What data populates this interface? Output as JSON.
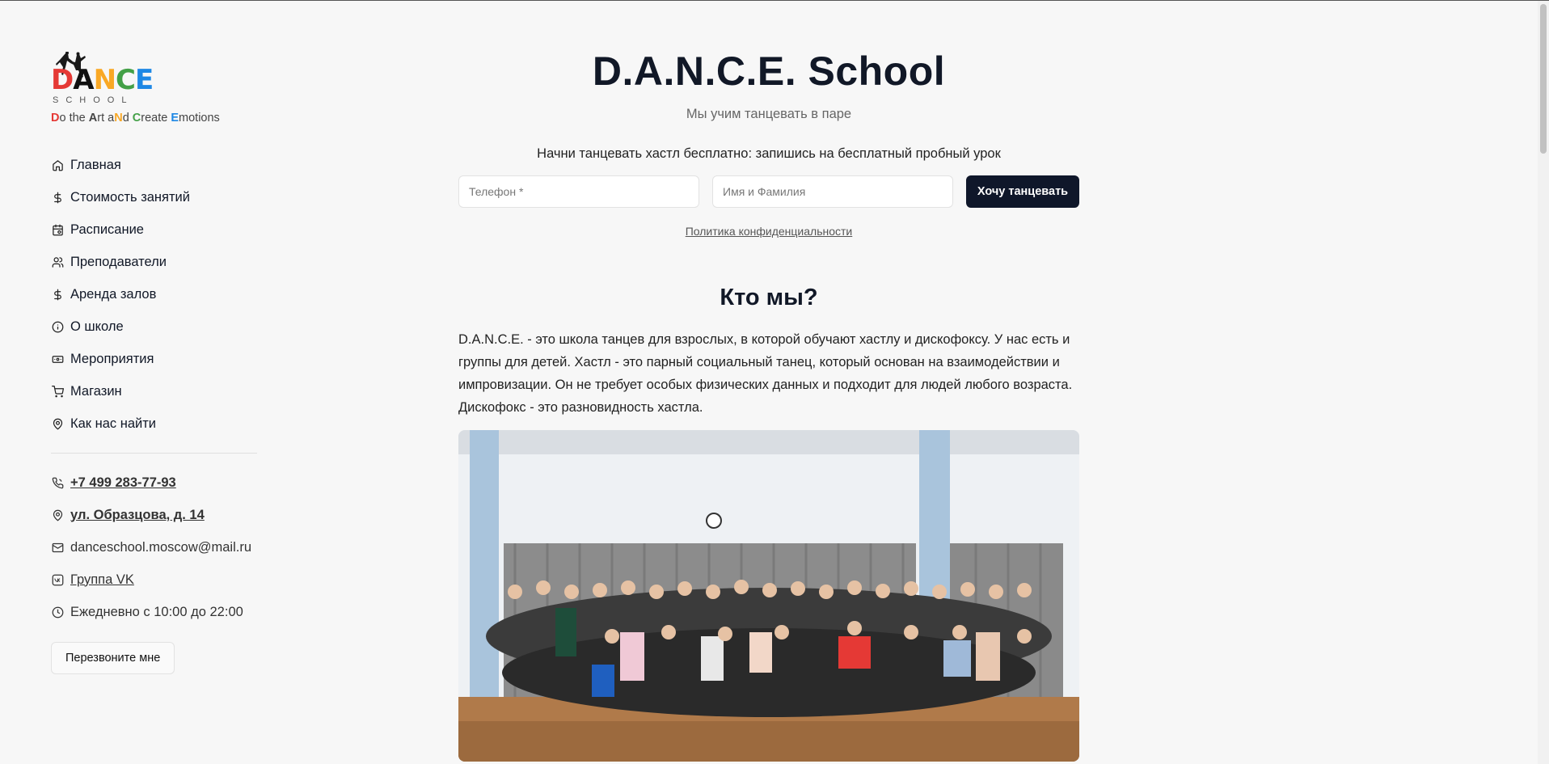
{
  "brand": {
    "logo_letters": [
      "D",
      "A",
      "N",
      "C",
      "E"
    ],
    "logo_colors": [
      "#e53935",
      "#111111",
      "#f9a825",
      "#43a047",
      "#1e88e5"
    ],
    "logo_subword": "SCHOOL",
    "tagline_parts": [
      {
        "t": "D",
        "b": true,
        "c": "#e53935"
      },
      {
        "t": "o the ",
        "b": false,
        "c": "#444444"
      },
      {
        "t": "A",
        "b": true,
        "c": "#444444"
      },
      {
        "t": "rt a",
        "b": false,
        "c": "#444444"
      },
      {
        "t": "N",
        "b": true,
        "c": "#f9a825"
      },
      {
        "t": "d ",
        "b": false,
        "c": "#444444"
      },
      {
        "t": "C",
        "b": true,
        "c": "#43a047"
      },
      {
        "t": "reate ",
        "b": false,
        "c": "#444444"
      },
      {
        "t": "E",
        "b": true,
        "c": "#1e88e5"
      },
      {
        "t": "motions",
        "b": false,
        "c": "#444444"
      }
    ]
  },
  "sidebar": {
    "nav": [
      {
        "label": "Главная",
        "icon": "home-icon"
      },
      {
        "label": "Стоимость занятий",
        "icon": "dollar-icon"
      },
      {
        "label": "Расписание",
        "icon": "calendar-icon"
      },
      {
        "label": "Преподаватели",
        "icon": "users-icon"
      },
      {
        "label": "Аренда залов",
        "icon": "dollar-icon"
      },
      {
        "label": "О школе",
        "icon": "info-icon"
      },
      {
        "label": "Мероприятия",
        "icon": "ticket-icon"
      },
      {
        "label": "Магазин",
        "icon": "cart-icon"
      },
      {
        "label": "Как нас найти",
        "icon": "map-pin-icon"
      }
    ],
    "contacts": {
      "phone": "+7 499 283-77-93",
      "address": "ул. Образцова, д. 14",
      "email": "danceschool.moscow@mail.ru",
      "vk": "Группа VK",
      "hours": "Ежедневно с 10:00 до 22:00"
    },
    "callback_label": "Перезвоните мне"
  },
  "main": {
    "title": "D.A.N.C.E. School",
    "subtitle": "Мы учим танцевать в паре",
    "cta_text": "Начни танцевать хастл бесплатно: запишись на бесплатный пробный урок",
    "phone_placeholder": "Телефон *",
    "name_placeholder": "Имя и Фамилия",
    "submit_label": "Хочу танцевать",
    "privacy_label": "Политика конфиденциальности",
    "section_title": "Кто мы?",
    "about_text": "D.A.N.C.E. - это школа танцев для взрослых, в которой обучают хастлу и дискофоксу. У нас есть и группы для детей. Хастл - это парный социальный танец, который основан на взаимодействии и импровизации. Он не требует особых физических данных и подходит для людей любого возраста. Дискофокс - это разновидность хастла."
  }
}
